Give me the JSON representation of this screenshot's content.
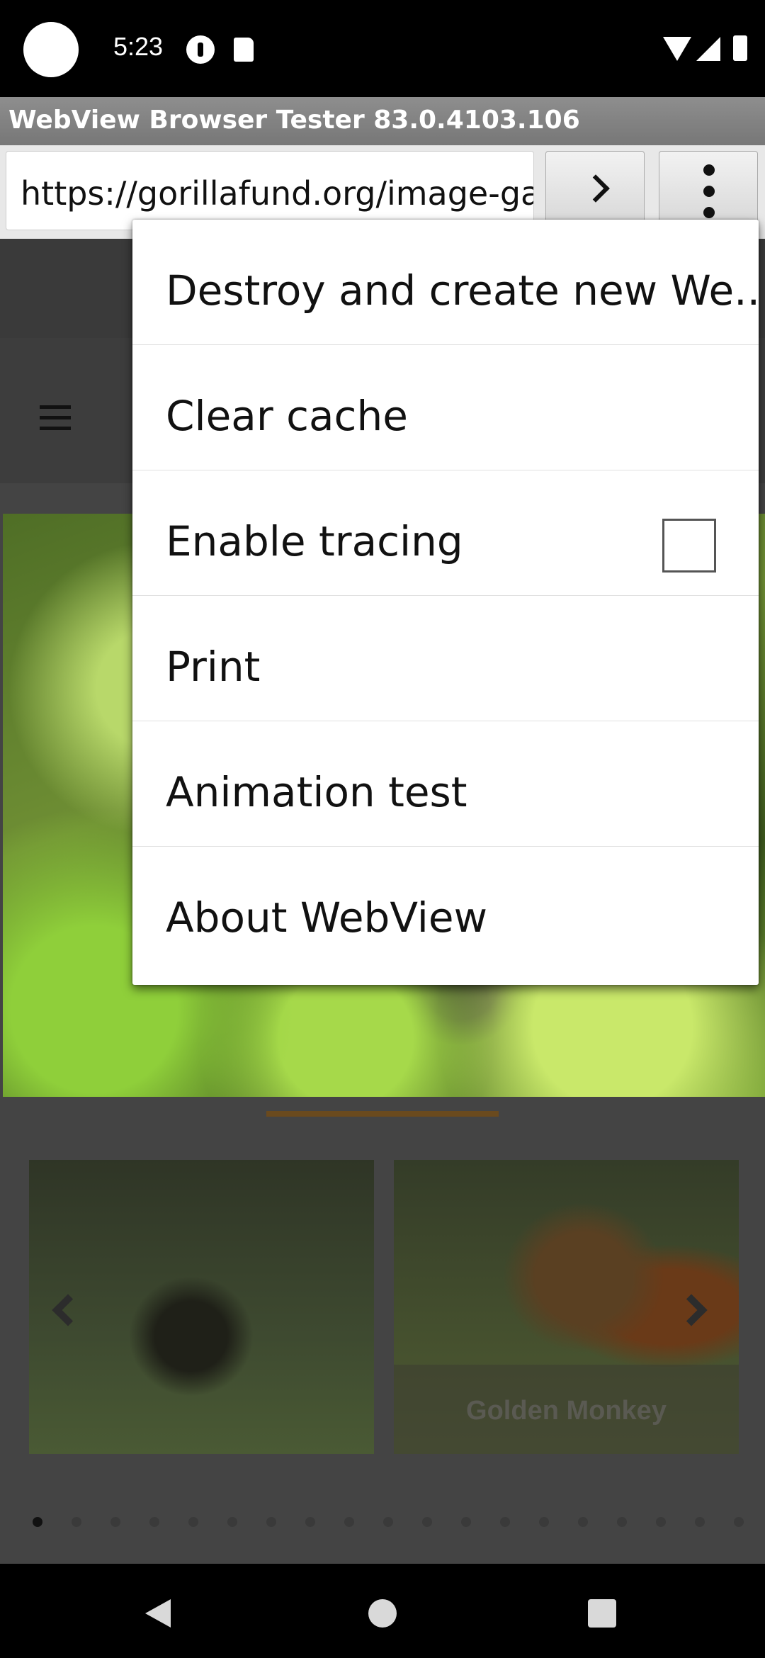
{
  "status_bar": {
    "time": "5:23"
  },
  "app": {
    "title": "WebView Browser Tester 83.0.4103.106"
  },
  "url_bar": {
    "value": "https://gorillafund.org/image-ga"
  },
  "page": {
    "thumbnails": [
      {
        "label": ""
      },
      {
        "label": "Golden Monkey"
      }
    ],
    "pager": {
      "count": 19,
      "active_index": 0
    }
  },
  "overflow_menu": {
    "items": [
      {
        "label": "Destroy and create new We.."
      },
      {
        "label": "Clear cache"
      },
      {
        "label": "Enable tracing",
        "checkbox": true,
        "checked": false
      },
      {
        "label": "Print"
      },
      {
        "label": "Animation test"
      },
      {
        "label": "About WebView"
      }
    ]
  },
  "icons": {
    "go": "chevron-right-icon",
    "menu": "more-vert-icon",
    "back": "back-icon",
    "home": "home-icon",
    "recents": "recents-icon"
  }
}
